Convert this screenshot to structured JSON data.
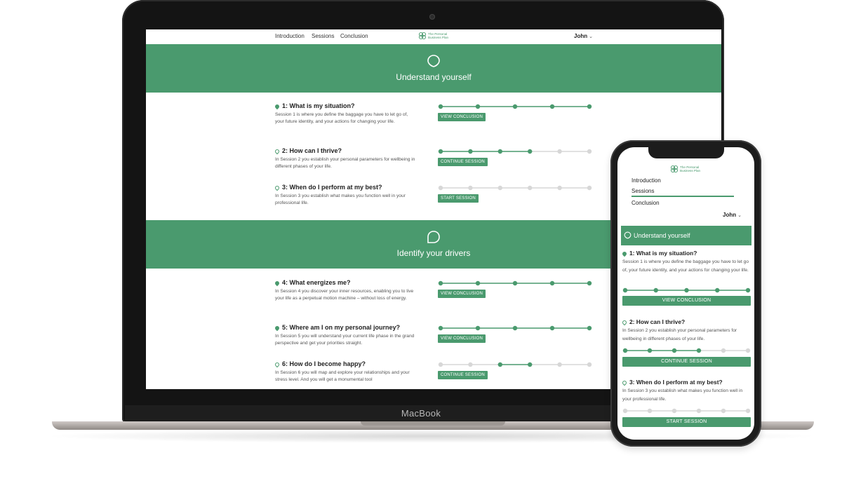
{
  "colors": {
    "accent": "#4a9a6e",
    "progress_inactive": "#d7d7d7",
    "text": "#222222",
    "muted_text": "#555555"
  },
  "laptop": {
    "brand_label": "MacBook",
    "nav": {
      "links": [
        "Introduction",
        "Sessions",
        "Conclusion"
      ],
      "logo_text_line1": "The Personal",
      "logo_text_line2": "Business Plan",
      "user": "John"
    },
    "sections": [
      {
        "title": "Understand yourself",
        "icon": "pin-icon",
        "sessions": [
          {
            "title": "1: What is my situation?",
            "dot": "filled",
            "description": "Session 1 is where you define the baggage you have to let go of, your future identity, and your actions for changing your life.",
            "progress": [
              1,
              1,
              1,
              1,
              1
            ],
            "button": "VIEW CONCLUSION"
          },
          {
            "title": "2: How can I thrive?",
            "dot": "hollow",
            "description": "In Session 2 you establish your personal parameters for wellbeing in different phases of your life.",
            "progress": [
              1,
              1,
              1,
              1,
              0,
              0
            ],
            "button": "CONTINUE SESSION"
          },
          {
            "title": "3: When do I perform at my best?",
            "dot": "hollow",
            "description": "In Session 3 you establish what makes you function well in your professional life.",
            "progress": [
              0,
              0,
              0,
              0,
              0,
              0
            ],
            "button": "START SESSION"
          }
        ]
      },
      {
        "title": "Identify your drivers",
        "icon": "drop-icon",
        "sessions": [
          {
            "title": "4: What energizes me?",
            "dot": "filled",
            "description": "In Session 4 you discover your inner resources, enabling you to live your life as a perpetual motion machine – without loss of energy.",
            "progress": [
              1,
              1,
              1,
              1,
              1
            ],
            "button": "VIEW CONCLUSION"
          },
          {
            "title": "5: Where am I on my personal journey?",
            "dot": "filled",
            "description": "In Session 5 you will understand your current life phase in the grand perspective and get your priorities straight.",
            "progress": [
              1,
              1,
              1,
              1,
              1
            ],
            "button": "VIEW CONCLUSION"
          },
          {
            "title": "6: How do I become happy?",
            "dot": "hollow",
            "description": "In Session 6 you will map and explore your relationships and your stress level. And you will get a monumental tool",
            "progress": [
              0,
              0,
              1,
              1,
              0,
              0
            ],
            "button": "CONTINUE SESSION"
          }
        ]
      }
    ]
  },
  "phone": {
    "logo_text_line1": "The Personal",
    "logo_text_line2": "Business Plan",
    "nav": [
      "Introduction",
      "Sessions",
      "Conclusion"
    ],
    "active_nav": "Sessions",
    "user": "John",
    "section_title": "Understand yourself",
    "sessions": [
      {
        "title": "1: What is my situation?",
        "dot": "filled",
        "description": "Session 1 is where you define the baggage you have to let go of, your future identity, and your actions for changing your life.",
        "progress": [
          1,
          1,
          1,
          1,
          1
        ],
        "button": "VIEW CONCLUSION"
      },
      {
        "title": "2: How can I thrive?",
        "dot": "hollow",
        "description": "In Session 2 you establish your personal parameters for wellbeing in different phases of your life.",
        "progress": [
          1,
          1,
          1,
          1,
          0,
          0
        ],
        "button": "CONTINUE SESSION"
      },
      {
        "title": "3: When do I perform at my best?",
        "dot": "hollow",
        "description": "In Session 3 you establish what makes you function well in your professional life.",
        "progress": [
          0,
          0,
          0,
          0,
          0,
          0
        ],
        "button": "START SESSION"
      }
    ]
  }
}
